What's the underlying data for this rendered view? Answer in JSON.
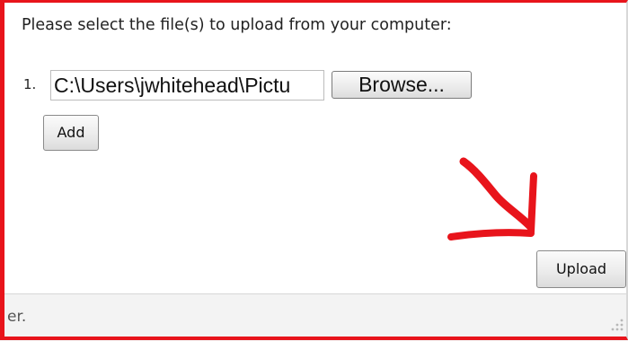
{
  "dialog": {
    "prompt": "Please select the file(s) to upload from your computer:",
    "file_rows": [
      {
        "number": "1.",
        "path_value": "C:\\Users\\jwhitehead\\Pictu",
        "browse_label": "Browse..."
      }
    ],
    "add_label": "Add",
    "upload_label": "Upload"
  },
  "footer": {
    "text": "er."
  },
  "colors": {
    "annotation_red": "#e8141b"
  },
  "annotation": {
    "icon": "hand-drawn-arrow-icon"
  }
}
